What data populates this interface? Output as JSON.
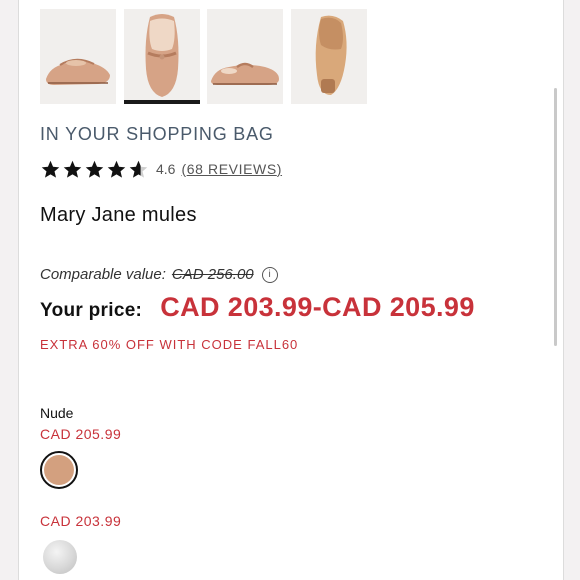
{
  "thumbnails": [
    {
      "alt": "side view",
      "icon": "shoe-side-view"
    },
    {
      "alt": "top view",
      "icon": "shoe-top-view",
      "selected": true
    },
    {
      "alt": "back view",
      "icon": "shoe-back-view"
    },
    {
      "alt": "sole view",
      "icon": "shoe-sole-view"
    }
  ],
  "bag_notice": "IN YOUR SHOPPING BAG",
  "rating": {
    "value": "4.6",
    "stars": 4.6,
    "reviews_label": "68 REVIEWS",
    "open_paren": "(",
    "close_paren": ")"
  },
  "product_name": "Mary Jane mules",
  "comparable": {
    "label": "Comparable value:",
    "value": "CAD 256.00",
    "info_icon": "i"
  },
  "price": {
    "label": "Your price:",
    "range": "CAD 203.99-CAD 205.99"
  },
  "promo": "EXTRA 60% OFF WITH CODE FALL60",
  "colors": {
    "selected_name": "Nude",
    "options": [
      {
        "price": "CAD 205.99",
        "swatch": "#d3a07f",
        "selected": true
      },
      {
        "price": "CAD 203.99",
        "swatch": "#d8d8d8",
        "selected": false
      }
    ]
  },
  "theme": {
    "accent_red": "#c8323a",
    "heading_blue": "#4a5a6b"
  }
}
